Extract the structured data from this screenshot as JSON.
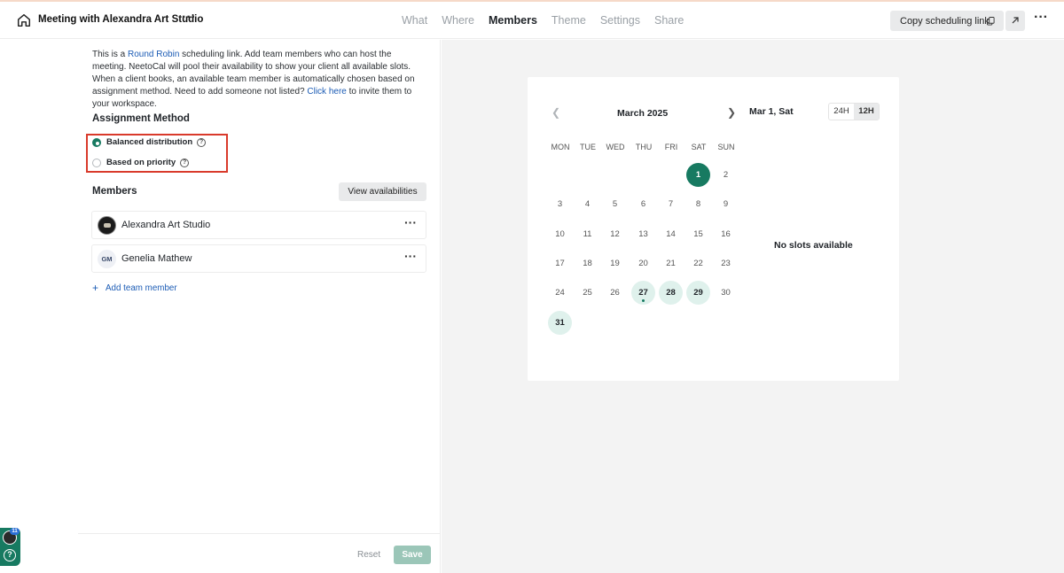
{
  "header": {
    "title": "Meeting with Alexandra Art Studio",
    "tabs": [
      {
        "label": "What",
        "active": false
      },
      {
        "label": "Where",
        "active": false
      },
      {
        "label": "Members",
        "active": true
      },
      {
        "label": "Theme",
        "active": false
      },
      {
        "label": "Settings",
        "active": false
      },
      {
        "label": "Share",
        "active": false
      }
    ],
    "copy_link_label": "Copy scheduling link",
    "icons": [
      "home-icon",
      "more-icon",
      "copy-icon",
      "external-link-icon"
    ]
  },
  "intro": {
    "text_1": "This is a ",
    "round_robin_link": "Round Robin",
    "text_2": " scheduling link. Add team members who can host the meeting. NeetoCal will pool their availability to show your client all available slots. When a client books, an available team member is automatically chosen based on assignment method. Need to add someone not listed? ",
    "click_here_link": "Click here",
    "text_3": " to invite them to your workspace."
  },
  "assignment": {
    "heading": "Assignment Method",
    "options": [
      {
        "label": "Balanced distribution",
        "checked": true
      },
      {
        "label": "Based on priority",
        "checked": false
      }
    ]
  },
  "members": {
    "heading": "Members",
    "view_availabilities_label": "View availabilities",
    "list": [
      {
        "name": "Alexandra Art Studio",
        "avatar": "photo"
      },
      {
        "name": "Genelia Mathew",
        "initials": "GM"
      }
    ],
    "add_label": "Add team member"
  },
  "footer": {
    "reset_label": "Reset",
    "save_label": "Save"
  },
  "calendar": {
    "month_label": "March 2025",
    "selected_date_label": "Mar 1, Sat",
    "formats": [
      {
        "label": "24H",
        "active": false
      },
      {
        "label": "12H",
        "active": true
      }
    ],
    "weekdays": [
      "MON",
      "TUE",
      "WED",
      "THU",
      "FRI",
      "SAT",
      "SUN"
    ],
    "first_weekday_index": 5,
    "days_in_month": 31,
    "selected_day": 1,
    "available_days": [
      27,
      28,
      29,
      31
    ],
    "today_day": 27,
    "no_slots_text": "No slots available",
    "accent_color": "#177a61",
    "available_bg": "#dff1ec"
  },
  "widget": {
    "badge_count": "11"
  }
}
